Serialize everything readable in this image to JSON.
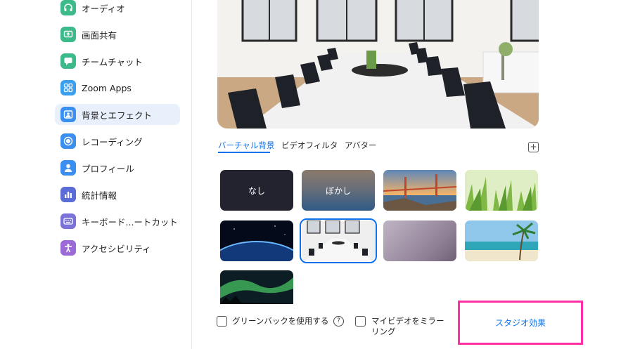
{
  "sidebar": {
    "items": [
      {
        "label": "オーディオ",
        "icon": "headphones-icon",
        "color": "#3dba8a"
      },
      {
        "label": "画面共有",
        "icon": "share-screen-icon",
        "color": "#3dba8a"
      },
      {
        "label": "チームチャット",
        "icon": "chat-icon",
        "color": "#3dba8a"
      },
      {
        "label": "Zoom Apps",
        "icon": "zoom-apps-icon",
        "color": "#3b9ff0"
      },
      {
        "label": "背景とエフェクト",
        "icon": "background-icon",
        "color": "#3b8ff0",
        "active": true
      },
      {
        "label": "レコーディング",
        "icon": "record-icon",
        "color": "#3b8ff0"
      },
      {
        "label": "プロフィール",
        "icon": "profile-icon",
        "color": "#3b8ff0"
      },
      {
        "label": "統計情報",
        "icon": "statistics-icon",
        "color": "#5b6bd8"
      },
      {
        "label": "キーボード...ートカット",
        "icon": "keyboard-icon",
        "color": "#7a72d9"
      },
      {
        "label": "アクセシビリティ",
        "icon": "accessibility-icon",
        "color": "#9b6ad6"
      }
    ]
  },
  "tabs": [
    {
      "label": "バーチャル背景",
      "active": true
    },
    {
      "label": "ビデオフィルタ",
      "active": false
    },
    {
      "label": "アバター",
      "active": false
    }
  ],
  "backgrounds": [
    {
      "label": "なし"
    },
    {
      "label": "ぼかし"
    },
    {
      "label": ""
    },
    {
      "label": ""
    },
    {
      "label": ""
    },
    {
      "label": "",
      "selected": true
    },
    {
      "label": ""
    },
    {
      "label": ""
    },
    {
      "label": ""
    }
  ],
  "options": {
    "green_screen": "グリーンバックを使用する",
    "mirror_line1": "マイビデオをミラー",
    "mirror_line2": "リング",
    "studio_effects": "スタジオ効果"
  },
  "colors": {
    "accent": "#0e72ed",
    "highlight": "#ff2fa8"
  }
}
